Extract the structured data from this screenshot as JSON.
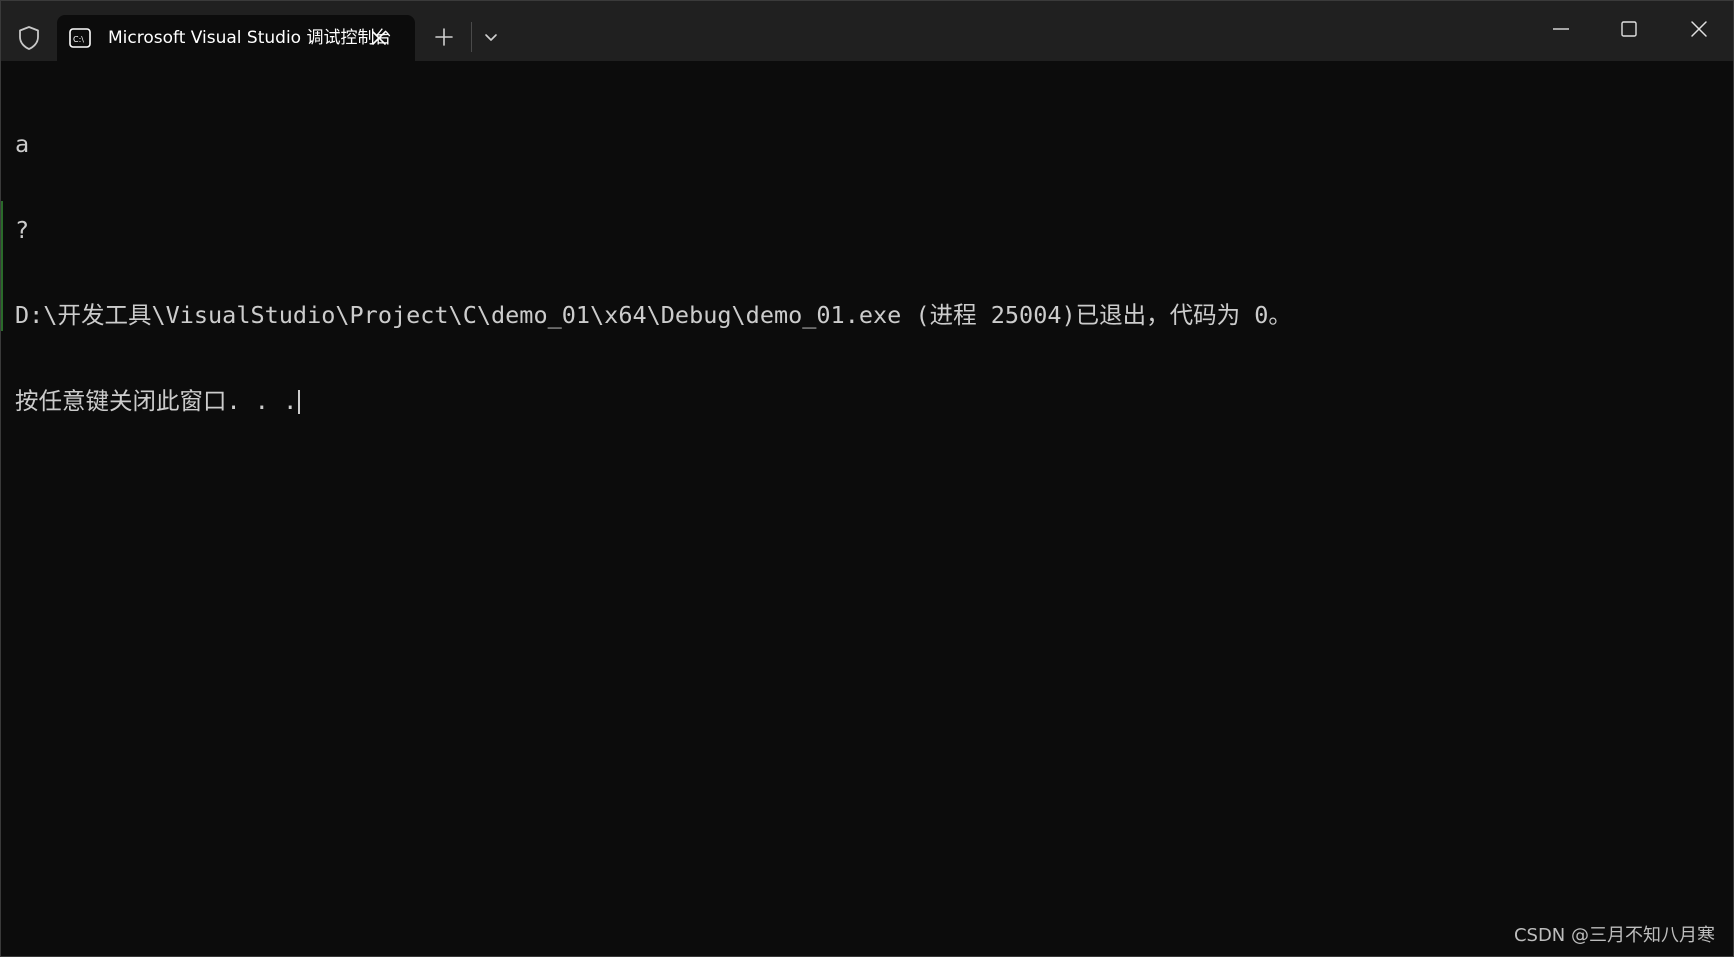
{
  "titlebar": {
    "shield_icon": "shield-icon",
    "tab": {
      "icon": "console-icon",
      "title": "Microsoft Visual Studio 调试控制台",
      "close_icon": "close-icon"
    },
    "new_tab_icon": "plus-icon",
    "dropdown_icon": "chevron-down-icon",
    "window_controls": {
      "minimize_icon": "minimize-icon",
      "maximize_icon": "maximize-icon",
      "close_icon": "close-icon"
    }
  },
  "console": {
    "lines": [
      "a",
      "?",
      "D:\\开发工具\\VisualStudio\\Project\\C\\demo_01\\x64\\Debug\\demo_01.exe (进程 25004)已退出，代码为 0。",
      "按任意键关闭此窗口. . ."
    ]
  },
  "watermark": "CSDN @三月不知八月寒",
  "colors": {
    "background": "#0c0c0c",
    "titlebar": "#202020",
    "text": "#cccccc"
  }
}
